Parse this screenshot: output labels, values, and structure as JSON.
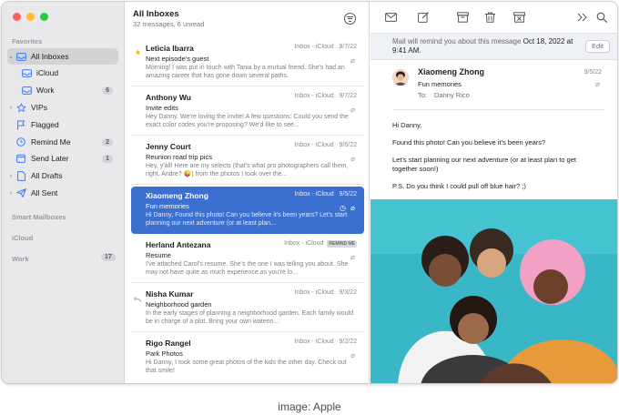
{
  "window_controls": {
    "close_color": "#fe5f57",
    "minimize_color": "#febc2e",
    "zoom_color": "#28c840"
  },
  "sidebar": {
    "favorites_heading": "Favorites",
    "favorites": [
      {
        "label": "All Inboxes",
        "icon": "tray-icon",
        "selected": true
      },
      {
        "label": "iCloud",
        "icon": "tray-icon"
      },
      {
        "label": "Work",
        "icon": "tray-icon",
        "badge": "6"
      },
      {
        "label": "VIPs",
        "icon": "star-icon"
      },
      {
        "label": "Flagged",
        "icon": "flag-icon"
      },
      {
        "label": "Remind Me",
        "icon": "clock-icon",
        "badge": "2"
      },
      {
        "label": "Send Later",
        "icon": "calendar-icon",
        "badge": "1"
      },
      {
        "label": "All Drafts",
        "icon": "document-icon"
      },
      {
        "label": "All Sent",
        "icon": "paperplane-icon"
      }
    ],
    "smart_mailboxes_heading": "Smart Mailboxes",
    "icloud_heading": "iCloud",
    "work_heading": "Work",
    "work_count": "17"
  },
  "message_list": {
    "title": "All Inboxes",
    "subtitle": "32 messages, 6 unread",
    "messages": [
      {
        "from": "Leticia Ibarra",
        "mailbox": "Inbox - iCloud",
        "date": "9/7/22",
        "subject": "Next episode's guest",
        "preview": "Morning! I was put in touch with Tania by a mutual friend. She's had an amazing career that has gone down several paths."
      },
      {
        "from": "Anthony Wu",
        "mailbox": "Inbox - iCloud",
        "date": "9/7/22",
        "subject": "Invite edits",
        "preview": "Hey Danny. We're loving the invite! A few questions: Could you send the exact color codes you're proposing? We'd like to see..."
      },
      {
        "from": "Jenny Court",
        "mailbox": "Inbox - iCloud",
        "date": "9/6/22",
        "subject": "Reunion road trip pics",
        "preview": "Hey, y'all! Here are my selects (that's what pro photographers call them, right, Andre? 😜) from the photos I took over the..."
      },
      {
        "from": "Xiaomeng Zhong",
        "mailbox": "Inbox - iCloud",
        "date": "9/5/22",
        "subject": "Fun memories",
        "preview": "Hi Danny, Found this photo! Can you believe it's been years? Let's start planning our next adventure (or at least plan..."
      },
      {
        "from": "Herland Antezana",
        "mailbox": "Inbox - iCloud",
        "tag": "REMIND ME",
        "date": "",
        "subject": "Resume",
        "preview": "I've attached Carol's resume. She's the one I was telling you about. She may not have quite as much experience as you're lo..."
      },
      {
        "from": "Nisha Kumar",
        "mailbox": "Inbox - iCloud",
        "date": "9/3/22",
        "subject": "Neighborhood garden",
        "preview": "In the early stages of planning a neighborhood garden. Each family would be in charge of a plot. Bring your own waterin..."
      },
      {
        "from": "Rigo Rangel",
        "mailbox": "Inbox - iCloud",
        "date": "9/2/22",
        "subject": "Park Photos",
        "preview": "Hi Danny, I took some great photos of the kids the other day. Check out that smile!"
      }
    ]
  },
  "reader": {
    "reminder_text": "Mail will remind you about this message ",
    "reminder_when": "Oct 18, 2022 at 9:41 AM.",
    "edit_label": "Edit",
    "sender": "Xiaomeng Zhong",
    "subject": "Fun memories",
    "to_label": "To:",
    "to_name": "Danny Rico",
    "date": "9/5/22",
    "body": [
      "Hi Danny,",
      "Found this photo! Can you believe it's been years?",
      "Let's start planning our next adventure (or at least plan to get together soon!)",
      "P.S. Do you think I could pull off blue hair? ;)"
    ]
  },
  "caption": "image: Apple",
  "colors": {
    "accent": "#3b6fd0",
    "sidebar_bg": "#e9e9eb",
    "sidebar_icon": "#3a7ef5",
    "star": "#f5b800",
    "photo_bg": "#39b7c6"
  }
}
